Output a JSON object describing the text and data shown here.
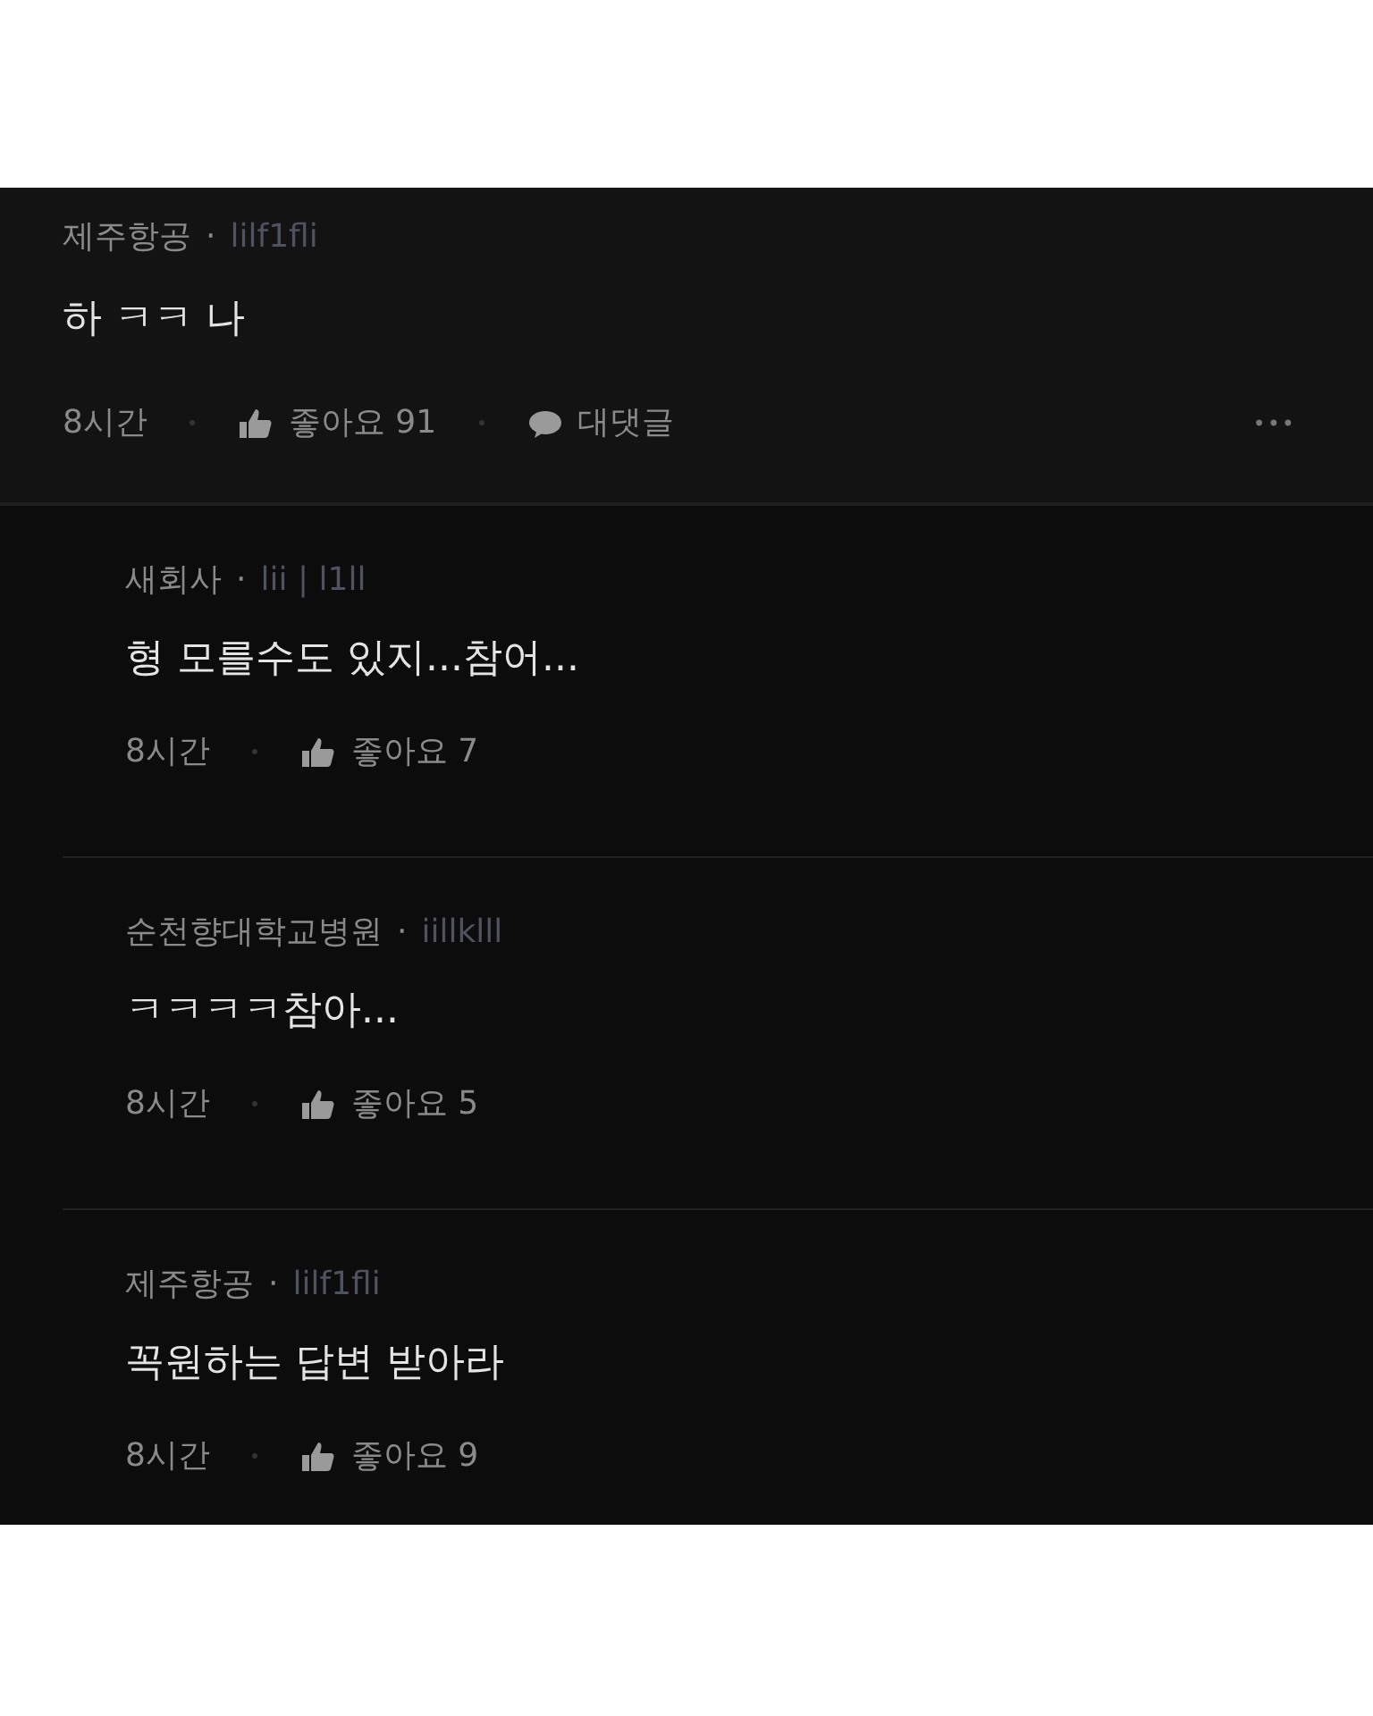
{
  "comment": {
    "author": "제주항공",
    "separator": "·",
    "handle": "lilf1fli",
    "text": "하 ㅋㅋ 나",
    "time": "8시간",
    "likes": "좋아요 91",
    "reply_label": "대댓글",
    "more": "•••"
  },
  "replies": [
    {
      "author": "새회사",
      "separator": "·",
      "handle": "lii | l1ll",
      "text": "형 모를수도 있지...참어...",
      "time": "8시간",
      "likes": "좋아요 7"
    },
    {
      "author": "순천향대학교병원",
      "separator": "·",
      "handle": "iillklll",
      "text": "ㅋㅋㅋㅋ참아...",
      "time": "8시간",
      "likes": "좋아요 5"
    },
    {
      "author": "제주항공",
      "separator": "·",
      "handle": "lilf1fli",
      "text": "꼭원하는 답변 받아라",
      "time": "8시간",
      "likes": "좋아요 9"
    }
  ]
}
